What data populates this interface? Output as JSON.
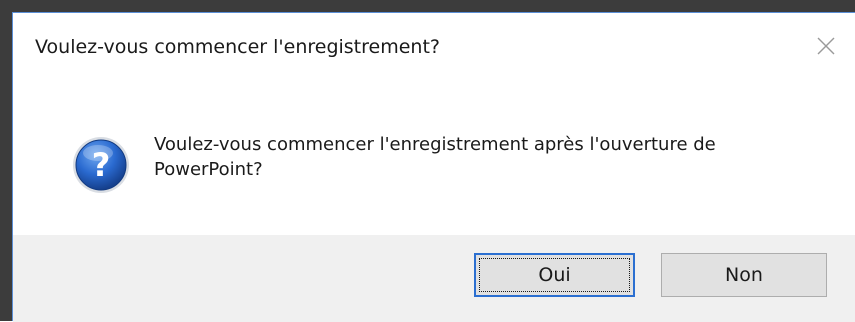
{
  "dialog": {
    "title": "Voulez-vous commencer l'enregistrement?",
    "close_icon": "close-icon",
    "icon": "question-icon",
    "message": "Voulez-vous commencer l'enregistrement après l'ouverture de PowerPoint?",
    "buttons": {
      "yes_label": "Oui",
      "no_label": "Non"
    }
  },
  "colors": {
    "accent_border": "#2b6fd1",
    "window_border": "#5b8fd6",
    "footer_bg": "#f0f0f0",
    "button_bg": "#e1e1e1",
    "icon_blue": "#1f5fbf"
  }
}
